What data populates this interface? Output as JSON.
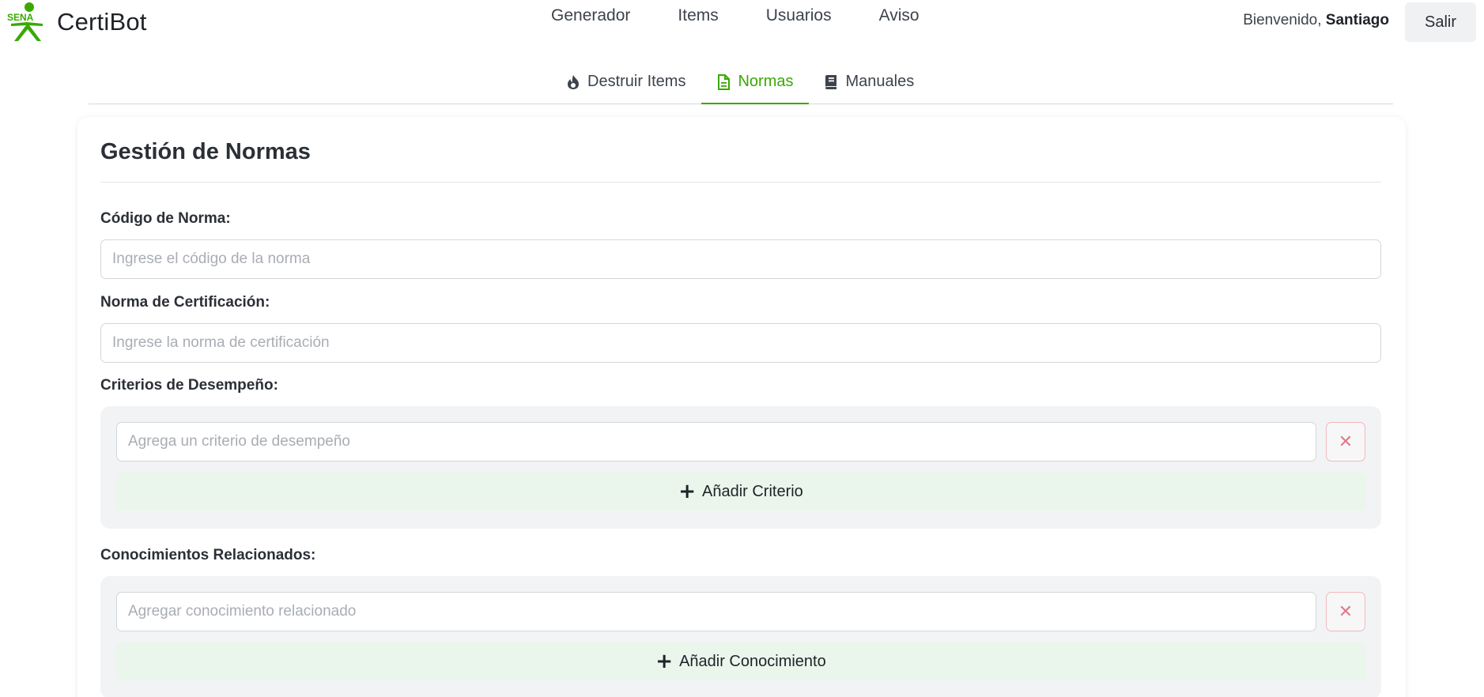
{
  "brand": {
    "logo_text": "SENA",
    "name": "CertiBot"
  },
  "nav": {
    "links": [
      "Generador",
      "Items",
      "Usuarios",
      "Aviso"
    ]
  },
  "user": {
    "greeting": "Bienvenido,",
    "name": "Santiago",
    "logout_label": "Salir"
  },
  "tabs": [
    {
      "label": "Destruir Items",
      "icon": "fire-icon"
    },
    {
      "label": "Normas",
      "icon": "document-icon",
      "active": true
    },
    {
      "label": "Manuales",
      "icon": "book-icon"
    }
  ],
  "form": {
    "title": "Gestión de Normas",
    "codigo": {
      "label": "Código de Norma:",
      "placeholder": "Ingrese el código de la norma",
      "value": ""
    },
    "norma": {
      "label": "Norma de Certificación:",
      "placeholder": "Ingrese la norma de certificación",
      "value": ""
    },
    "criterios": {
      "label": "Criterios de Desempeño:",
      "placeholder": "Agrega un criterio de desempeño",
      "remove_label": "✕",
      "add_label": "Añadir Criterio"
    },
    "conocimientos": {
      "label": "Conocimientos Relacionados:",
      "placeholder": "Agregar conocimiento relacionado",
      "remove_label": "✕",
      "add_label": "Añadir Conocimiento"
    }
  },
  "colors": {
    "accent": "#39a900",
    "danger": "#e07a8a",
    "add_bg": "#eaf6ec"
  }
}
